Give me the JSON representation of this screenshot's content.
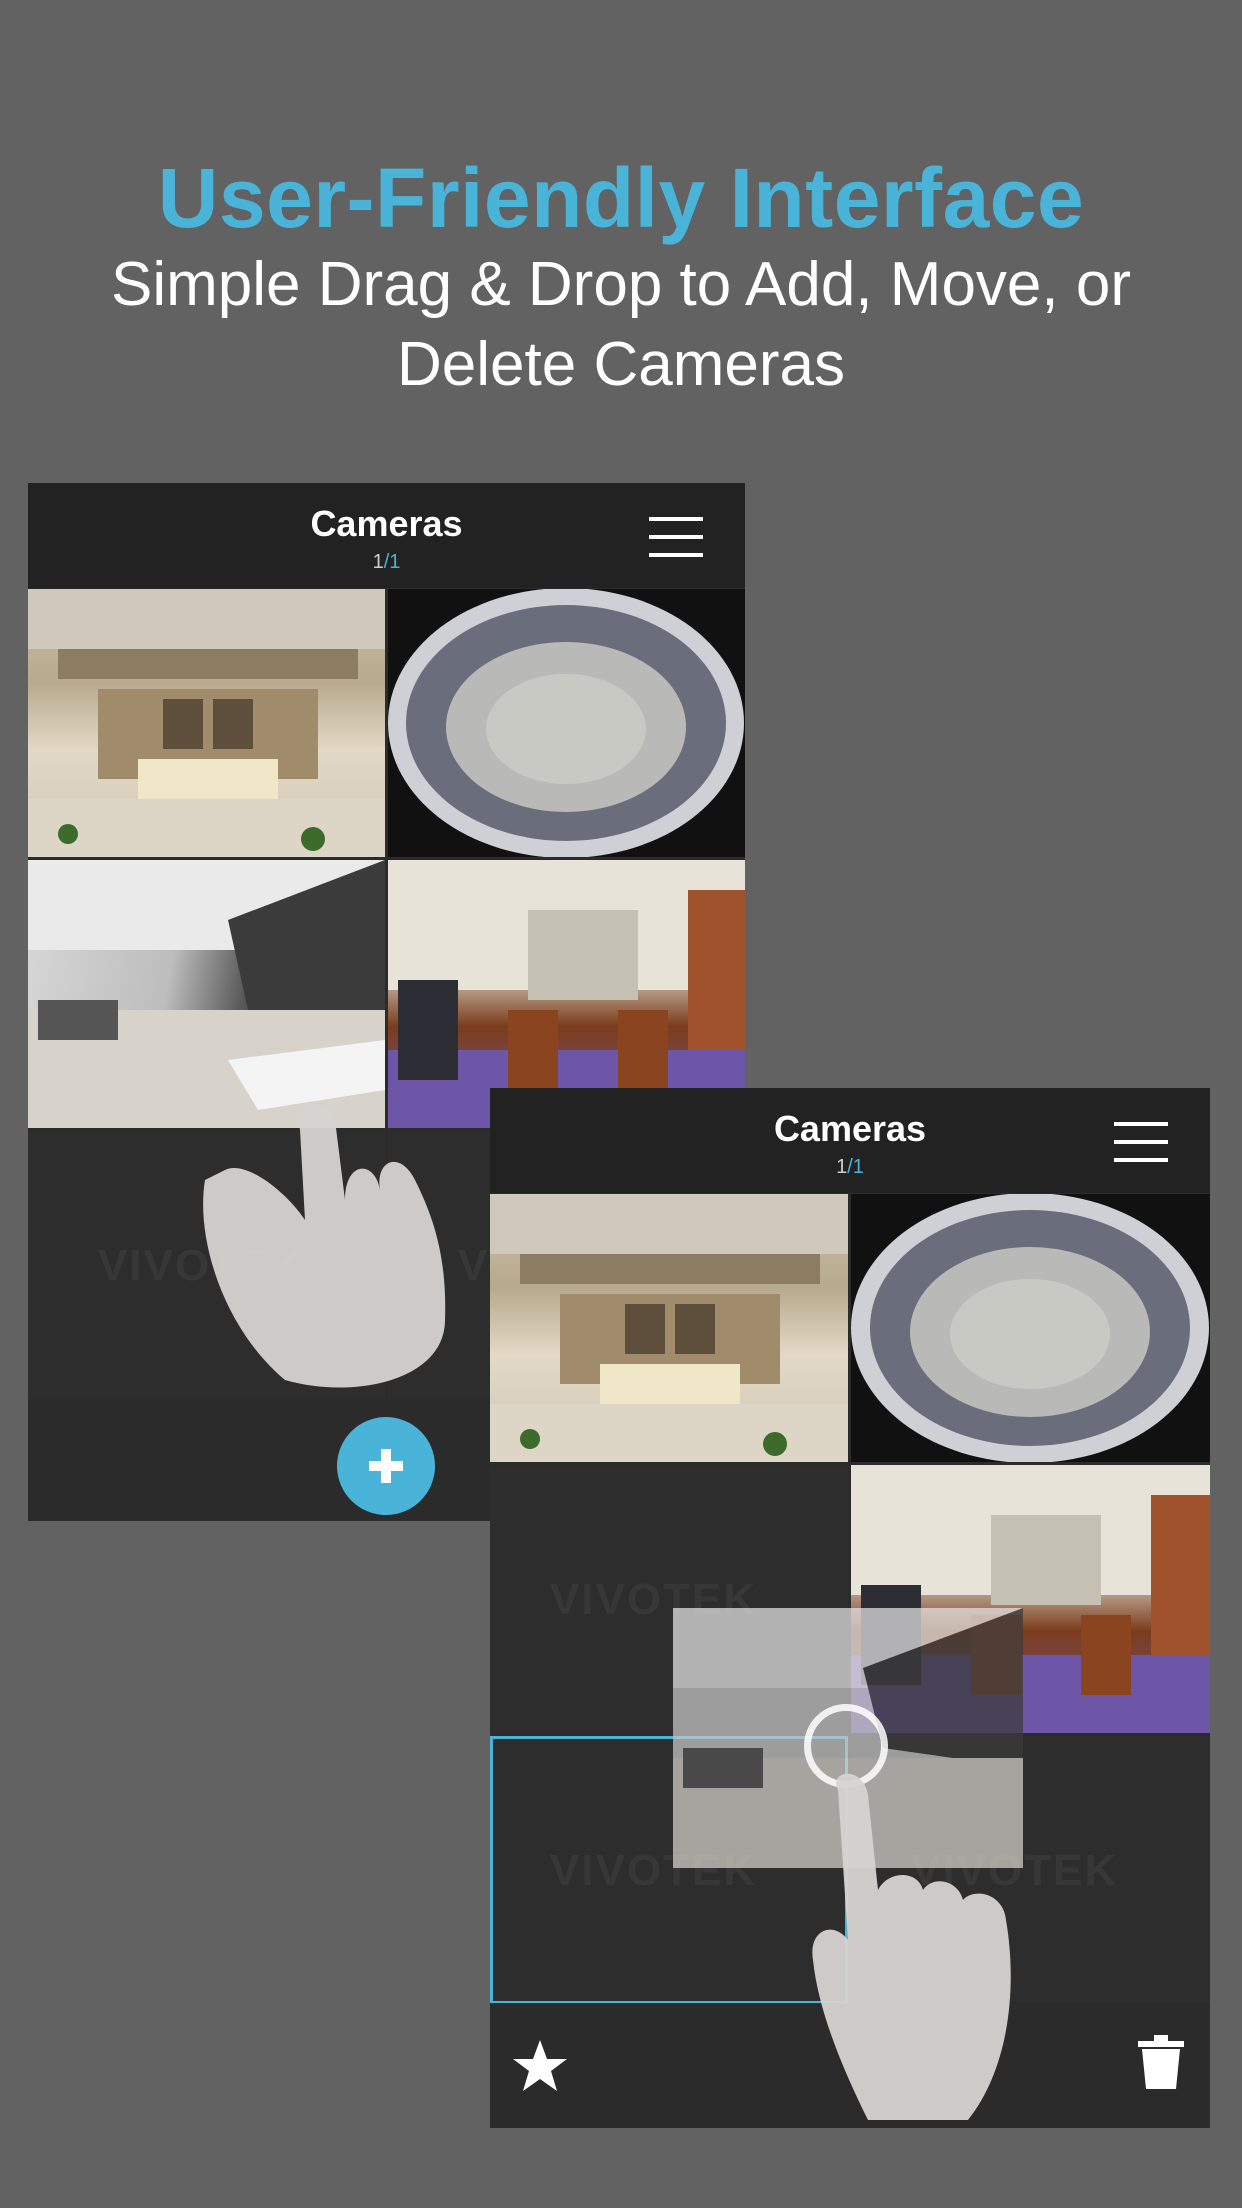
{
  "headline": "User-Friendly Interface",
  "subline_1": "Simple Drag & Drop to Add, Move, or",
  "subline_2": "Delete Cameras",
  "phone_left": {
    "title": "Cameras",
    "page_current": "1",
    "page_sep": "/",
    "page_total": "1",
    "watermark": "VIVOTEK",
    "fab_icon": "plus-icon",
    "menu_icon": "hamburger-menu-icon"
  },
  "phone_right": {
    "title": "Cameras",
    "page_current": "1",
    "page_sep": "/",
    "page_total": "1",
    "watermark": "VIVOTEK",
    "favorite_icon": "star-icon",
    "delete_icon": "trash-icon",
    "menu_icon": "hamburger-menu-icon"
  },
  "colors": {
    "accent": "#4ab4d8",
    "background": "#626262",
    "bar": "#222222",
    "panel": "#2b2b2b"
  }
}
